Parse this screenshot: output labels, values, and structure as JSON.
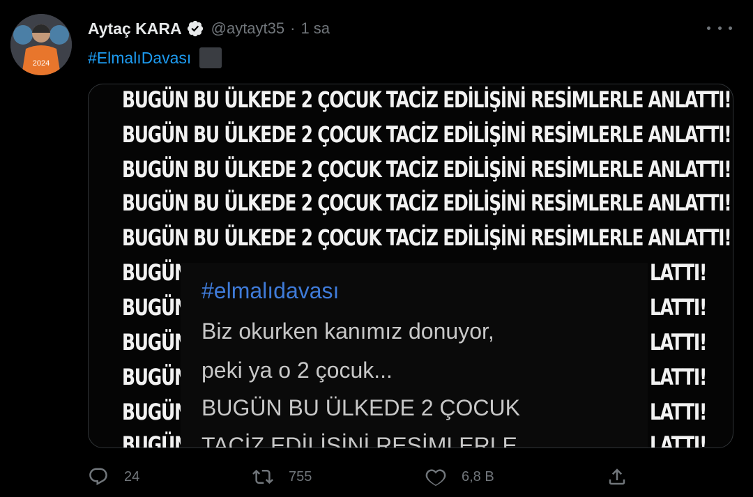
{
  "tweet": {
    "author_name": "Aytaç KARA",
    "handle": "@aytayt35",
    "separator": "·",
    "time": "1 sa",
    "hashtag": "#ElmalıDavası"
  },
  "avatar": {
    "jersey_number": "2024"
  },
  "media": {
    "banner_text": "BUGÜN BU ÜLKEDE 2 ÇOCUK TACİZ EDİLİŞİNİ RESİMLERLE ANLATTI!",
    "left_fragment": "BUGÜN",
    "right_fragment": "LATTI!",
    "overlay": {
      "hashtag": "#elmalıdavası",
      "line1": "Biz okurken kanımız donuyor,",
      "line2": "peki ya o 2 çocuk...",
      "line3": "BUGÜN BU ÜLKEDE 2 ÇOCUK",
      "line4": "TACİZ EDİLİŞİNİ RESİMLERLE"
    }
  },
  "actions": {
    "reply_count": "24",
    "retweet_count": "755",
    "like_count": "6,8 B"
  },
  "colors": {
    "background": "#000000",
    "accent": "#1d9bf0",
    "muted": "#71767b"
  },
  "icons": [
    "verified-badge-icon",
    "more-icon",
    "reply-icon",
    "retweet-icon",
    "like-icon",
    "share-icon"
  ]
}
